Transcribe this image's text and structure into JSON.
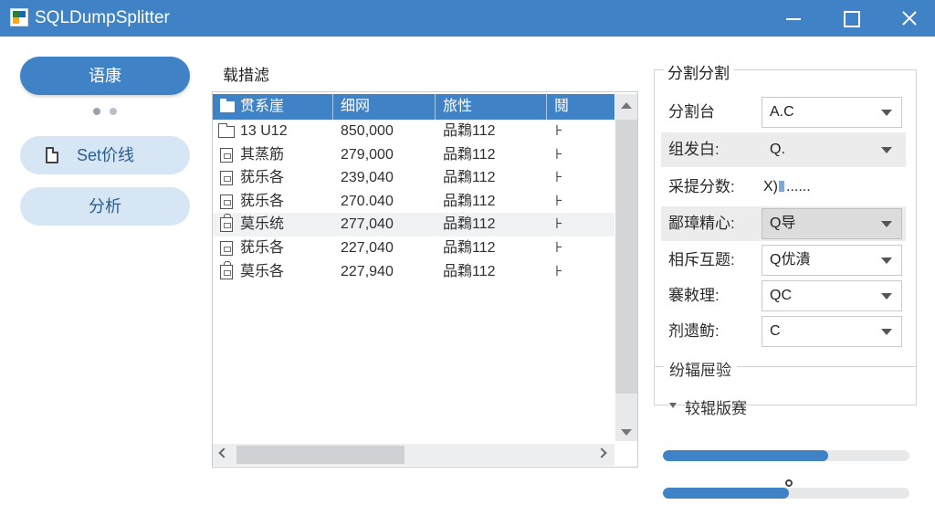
{
  "window": {
    "title": "SQLDumpSplitter",
    "colors": {
      "titlebar": "#3f83c6",
      "accent": "#3f83c6",
      "nav_secondary": "#d6e6f5"
    }
  },
  "sidebar": {
    "primary_label": "语康",
    "items": [
      {
        "label": "Set价线",
        "icon": "document-icon"
      },
      {
        "label": "分析"
      }
    ],
    "pager_dots": 2
  },
  "files": {
    "section_title": "载措滤",
    "columns": [
      "贯系崖",
      "细网",
      "旅性",
      "鬩"
    ],
    "rows": [
      {
        "icon": "folder-icon",
        "name": "13 U12",
        "size": "850,000",
        "type": "品鶔112",
        "extra": "⊦"
      },
      {
        "icon": "file-icon",
        "name": "其蒸筋",
        "size": "279,000",
        "type": "品鶔112",
        "extra": "⊦"
      },
      {
        "icon": "file-icon",
        "name": "莸乐各",
        "size": "239,040",
        "type": "品鶔112",
        "extra": "⊦"
      },
      {
        "icon": "file-icon",
        "name": "莸乐各",
        "size": "270.040",
        "type": "品鶔112",
        "extra": "⊦"
      },
      {
        "icon": "lock-icon",
        "name": "莫乐统",
        "size": "277,040",
        "type": "品鶔112",
        "extra": "⊦"
      },
      {
        "icon": "file-icon",
        "name": "莸乐各",
        "size": "227,040",
        "type": "品鶔112",
        "extra": "⊦"
      },
      {
        "icon": "lock-icon",
        "name": "莫乐各",
        "size": "227,940",
        "type": "品鶔112",
        "extra": "⊦"
      }
    ]
  },
  "settings": {
    "group_title": "分割分割",
    "fields": [
      {
        "label": "分割台",
        "value": "A.C"
      },
      {
        "label": "组发白:",
        "value": "Q."
      },
      {
        "label": "采提分数:",
        "value": "X)",
        "value_suffix": "......"
      },
      {
        "label": "鄙璋精心:",
        "value": "Q导"
      },
      {
        "label": "相斥互题:",
        "value": "Q优潰"
      },
      {
        "label": "褰敕理:",
        "value": "QC"
      },
      {
        "label": "剂遗鲂:",
        "value": "C"
      }
    ],
    "subsection_title": "纷辐屉验",
    "expander_label": "较辊版赛"
  },
  "progress": {
    "bar1_fraction": 0.67,
    "bar2_fraction": 0.51
  }
}
